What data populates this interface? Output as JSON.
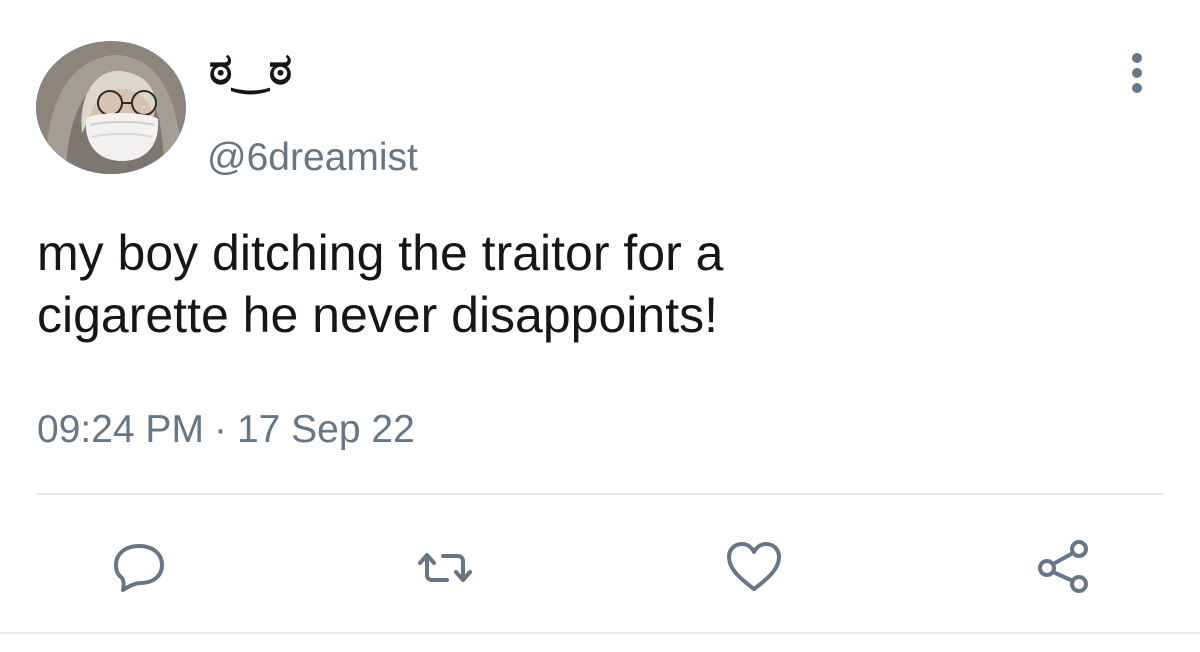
{
  "user": {
    "display_name": "ಠ‿ಠ",
    "handle": "@6dreamist"
  },
  "tweet": {
    "text": "my boy ditching the traitor for a\ncigarette he never disappoints!",
    "time": "09:24 PM",
    "separator": "·",
    "date": "17 Sep 22"
  },
  "actions": {
    "reply": "reply-icon",
    "retweet": "retweet-icon",
    "like": "heart-icon",
    "share": "share-icon",
    "more": "more-vertical-icon"
  },
  "colors": {
    "text": "#14171a",
    "secondary": "#657786",
    "divider": "#e6ecf0"
  }
}
